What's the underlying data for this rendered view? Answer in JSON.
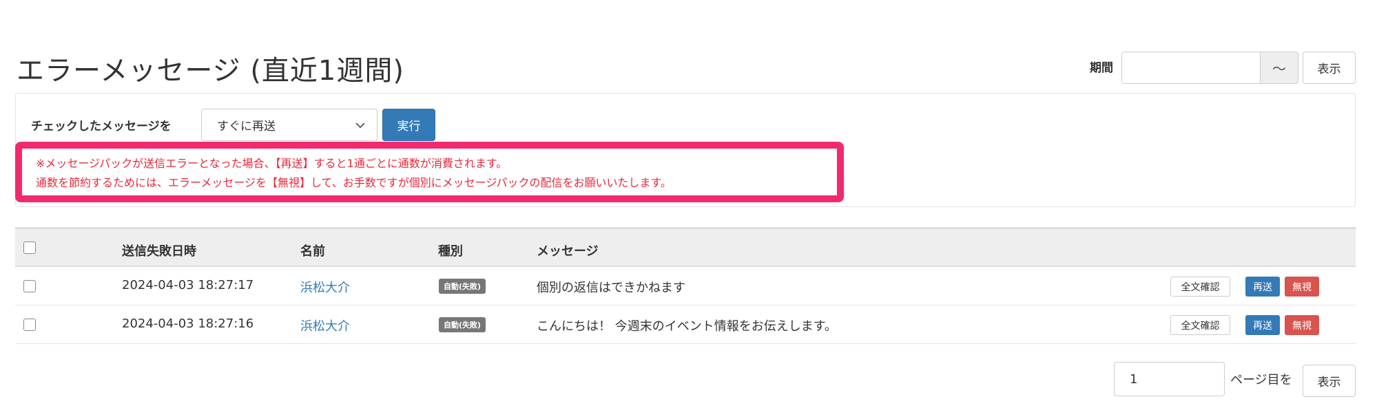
{
  "page": {
    "title": "エラーメッセージ (直近1週間)"
  },
  "period": {
    "label": "期間",
    "value": "",
    "tilde": "〜",
    "show_label": "表示"
  },
  "bulk": {
    "label": "チェックしたメッセージを",
    "selected": "すぐに再送",
    "execute_label": "実行"
  },
  "warning": {
    "line1": "※メッセージパックが送信エラーとなった場合、【再送】すると1通ごとに通数が消費されます。",
    "line2": "通数を節約するためには、エラーメッセージを【無視】して、お手数ですが個別にメッセージパックの配信をお願いいたします。"
  },
  "table": {
    "headers": {
      "date": "送信失敗日時",
      "name": "名前",
      "type": "種別",
      "message": "メッセージ"
    },
    "rows": [
      {
        "date": "2024-04-03 18:27:17",
        "name": "浜松大介",
        "type": "自動(失敗)",
        "message": "個別の返信はできかねます",
        "full_label": "全文確認",
        "resend_label": "再送",
        "ignore_label": "無視"
      },
      {
        "date": "2024-04-03 18:27:16",
        "name": "浜松大介",
        "type": "自動(失敗)",
        "message": "こんにちは！ 今週末のイベント情報をお伝えします。",
        "full_label": "全文確認",
        "resend_label": "再送",
        "ignore_label": "無視"
      }
    ]
  },
  "pagination": {
    "page_value": "1",
    "suffix": "ページ目を",
    "show_label": "表示"
  },
  "colors": {
    "primary": "#337ab7",
    "danger": "#d9534f",
    "warning_border": "#f2296d",
    "warning_text": "#e8283a",
    "badge": "#777777"
  },
  "icons": {
    "select_arrow": "chevron-down-icon"
  }
}
